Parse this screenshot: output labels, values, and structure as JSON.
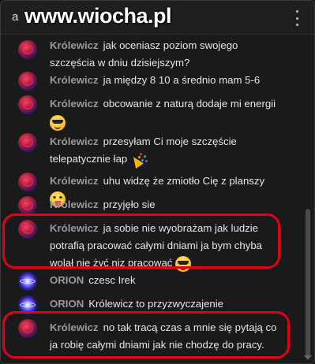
{
  "header": {
    "title_fragment": "a",
    "watermark": "www.wiocha.pl"
  },
  "messages": [
    {
      "author": "Królewicz",
      "text": "jak oceniasz poziom swojego szczęścia w dniu dzisiejszym?"
    },
    {
      "author": "Królewicz",
      "text": "ja między 8 10 a średnio mam 5-6"
    },
    {
      "author": "Królewicz",
      "text": "obcowanie z naturą dodaje mi energii",
      "emoji": "smiling-face-with-sunglasses"
    },
    {
      "author": "Królewicz",
      "text": "przesyłam Ci moje szczęście telepatycznie łap",
      "emoji": "party-popper"
    },
    {
      "author": "Królewicz",
      "text": "uhu widzę że zmiotło Cię z planszy",
      "emoji": "face-with-tongue"
    },
    {
      "author": "Królewicz",
      "text": "przyjęło sie"
    },
    {
      "author": "Królewicz",
      "text": "ja sobie nie wyobrażam jak ludzie potrafią pracować całymi dniami ja bym chyba wolał nie żyć niz pracować",
      "emoji": "smiling-face-with-sunglasses"
    },
    {
      "author": "ORION",
      "text": "czesc Irek"
    },
    {
      "author": "ORION",
      "text": "Królewicz to przyzwyczajenie"
    },
    {
      "author": "Królewicz",
      "text": "no tak tracą czas a mnie się pytają co ja robię całymi dniami jak nie chodzę do pracy."
    }
  ],
  "colors": {
    "highlight": "#e3001b",
    "background": "#1a1a1a",
    "author": "#9a9a9a",
    "text": "#e6e6e6"
  }
}
